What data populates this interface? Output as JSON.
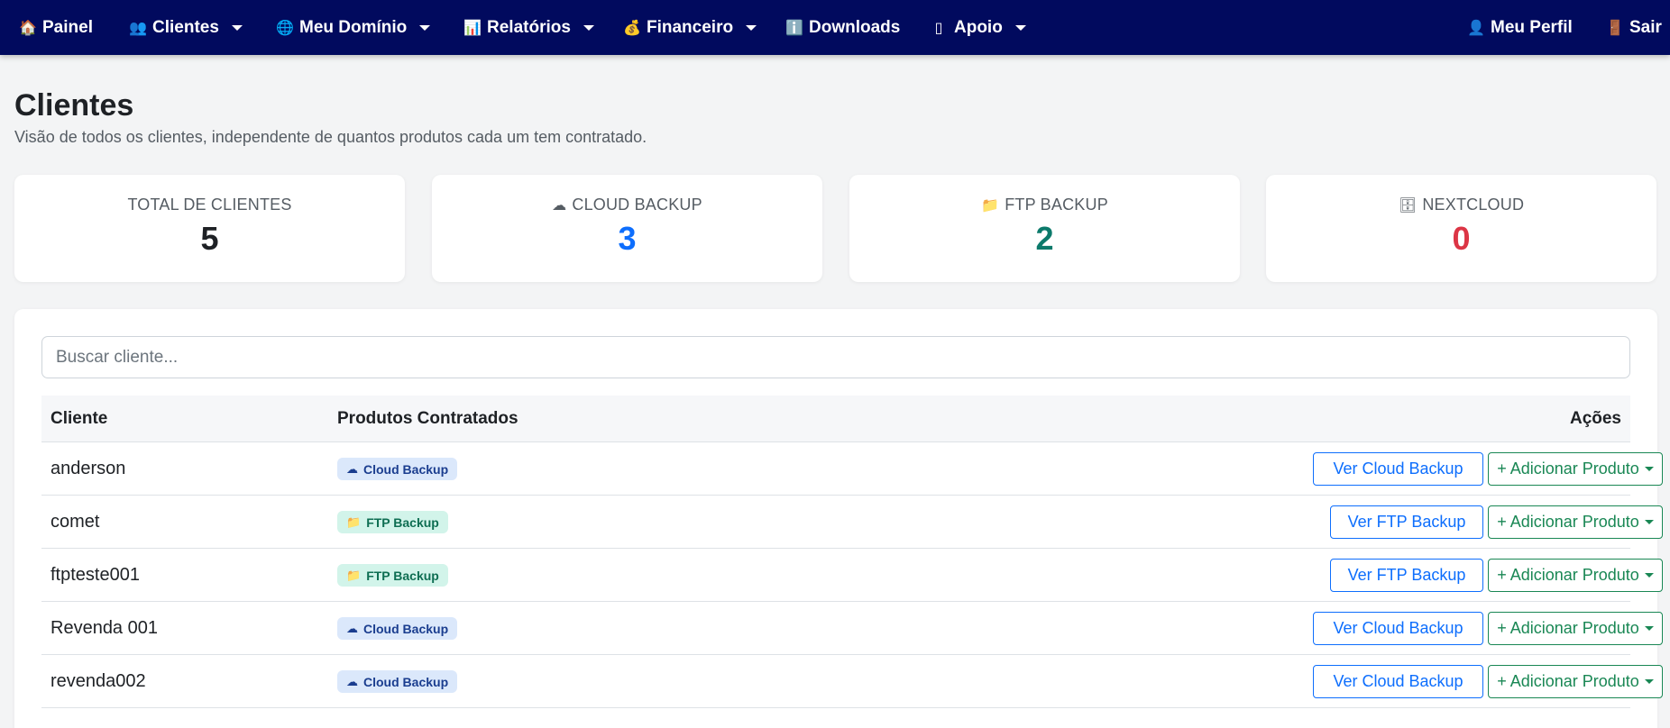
{
  "nav": {
    "left": [
      {
        "icon": "🏠",
        "label": "Painel"
      },
      {
        "icon": "👥",
        "label": "Clientes"
      },
      {
        "icon": "🌐",
        "label": "Meu Domínio"
      },
      {
        "icon": "📊",
        "label": "Relatórios"
      },
      {
        "icon": "💰",
        "label": "Financeiro"
      },
      {
        "icon": "ℹ️",
        "label": "Downloads"
      },
      {
        "icon": "▯",
        "label": "Apoio"
      }
    ],
    "right": [
      {
        "icon": "👤",
        "label": "Meu Perfil"
      },
      {
        "icon": "🚪",
        "label": "Sair"
      }
    ]
  },
  "header": {
    "title": "Clientes",
    "subtitle": "Visão de todos os clientes, independente de quantos produtos cada um tem contratado."
  },
  "stats": [
    {
      "icon": "",
      "label": "TOTAL DE CLIENTES",
      "value": "5",
      "color": "#1e2125"
    },
    {
      "icon": "☁",
      "label": "CLOUD BACKUP",
      "value": "3",
      "color": "#0d6efd"
    },
    {
      "icon": "📁",
      "label": "FTP BACKUP",
      "value": "2",
      "color": "#0c7a6b"
    },
    {
      "icon": "🗄",
      "label": "NEXTCLOUD",
      "value": "0",
      "color": "#dc3545"
    }
  ],
  "search": {
    "placeholder": "Buscar cliente...",
    "value": ""
  },
  "table": {
    "headers": {
      "client": "Cliente",
      "products": "Produtos Contratados",
      "actions": "Ações"
    },
    "add_label": "+ Adicionar Produto",
    "rows": [
      {
        "name": "anderson",
        "badge_icon": "☁",
        "badge": "Cloud Backup",
        "type": "cloud",
        "view_label": "Ver Cloud Backup"
      },
      {
        "name": "comet",
        "badge_icon": "📁",
        "badge": "FTP Backup",
        "type": "ftp",
        "view_label": "Ver FTP Backup"
      },
      {
        "name": "ftpteste001",
        "badge_icon": "📁",
        "badge": "FTP Backup",
        "type": "ftp",
        "view_label": "Ver FTP Backup"
      },
      {
        "name": "Revenda 001",
        "badge_icon": "☁",
        "badge": "Cloud Backup",
        "type": "cloud",
        "view_label": "Ver Cloud Backup"
      },
      {
        "name": "revenda002",
        "badge_icon": "☁",
        "badge": "Cloud Backup",
        "type": "cloud",
        "view_label": "Ver Cloud Backup"
      }
    ]
  }
}
